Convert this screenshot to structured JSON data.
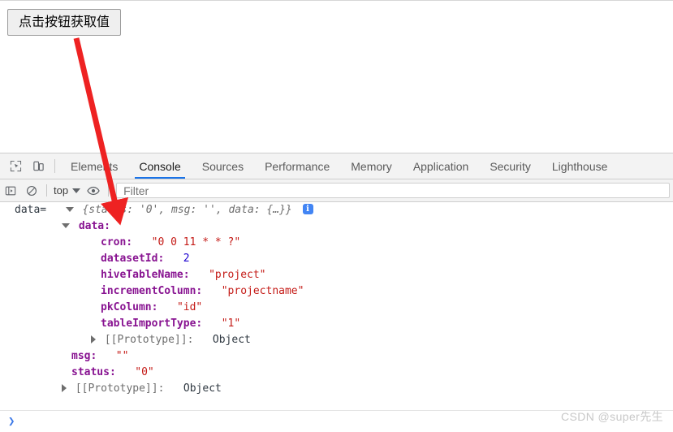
{
  "page": {
    "button_label": "点击按钮获取值"
  },
  "devtools": {
    "toolbar_icons": [
      {
        "name": "inspect-element-icon"
      },
      {
        "name": "device-toolbar-icon"
      }
    ],
    "tabs": [
      {
        "label": "Elements",
        "active": false
      },
      {
        "label": "Console",
        "active": true
      },
      {
        "label": "Sources",
        "active": false
      },
      {
        "label": "Performance",
        "active": false
      },
      {
        "label": "Memory",
        "active": false
      },
      {
        "label": "Application",
        "active": false
      },
      {
        "label": "Security",
        "active": false
      },
      {
        "label": "Lighthouse",
        "active": false
      }
    ],
    "console_toolbar": {
      "sidebar_toggle_icon": "console-sidebar-icon",
      "clear_icon": "clear-console-icon",
      "context_value": "top",
      "eye_icon": "live-expression-eye-icon",
      "filter_placeholder": "Filter",
      "filter_value": ""
    },
    "console_log": {
      "prefix": "data=",
      "preview": "{status: '0', msg: '', data: {…}}",
      "info_badge": "i",
      "data_key": "data:",
      "rows": [
        {
          "key": "cron:",
          "value": "\"0 0 11 * * ?\"",
          "type": "string"
        },
        {
          "key": "datasetId:",
          "value": "2",
          "type": "number"
        },
        {
          "key": "hiveTableName:",
          "value": "\"project\"",
          "type": "string"
        },
        {
          "key": "incrementColumn:",
          "value": "\"projectname\"",
          "type": "string"
        },
        {
          "key": "pkColumn:",
          "value": "\"id\"",
          "type": "string"
        },
        {
          "key": "tableImportType:",
          "value": "\"1\"",
          "type": "string"
        }
      ],
      "inner_prototype": {
        "key": "[[Prototype]]:",
        "value": "Object"
      },
      "msg_row": {
        "key": "msg:",
        "value": "\"\""
      },
      "status_row": {
        "key": "status:",
        "value": "\"0\""
      },
      "outer_prototype": {
        "key": "[[Prototype]]:",
        "value": "Object"
      }
    },
    "prompt_caret": "❯"
  },
  "watermark": "CSDN @super先生",
  "colors": {
    "accent_tab": "#1a73e8",
    "property_name": "#881391",
    "string_value": "#c41a16",
    "number_value": "#1c00cf",
    "info_badge": "#4285f4",
    "annotation_arrow": "#ee2222"
  }
}
